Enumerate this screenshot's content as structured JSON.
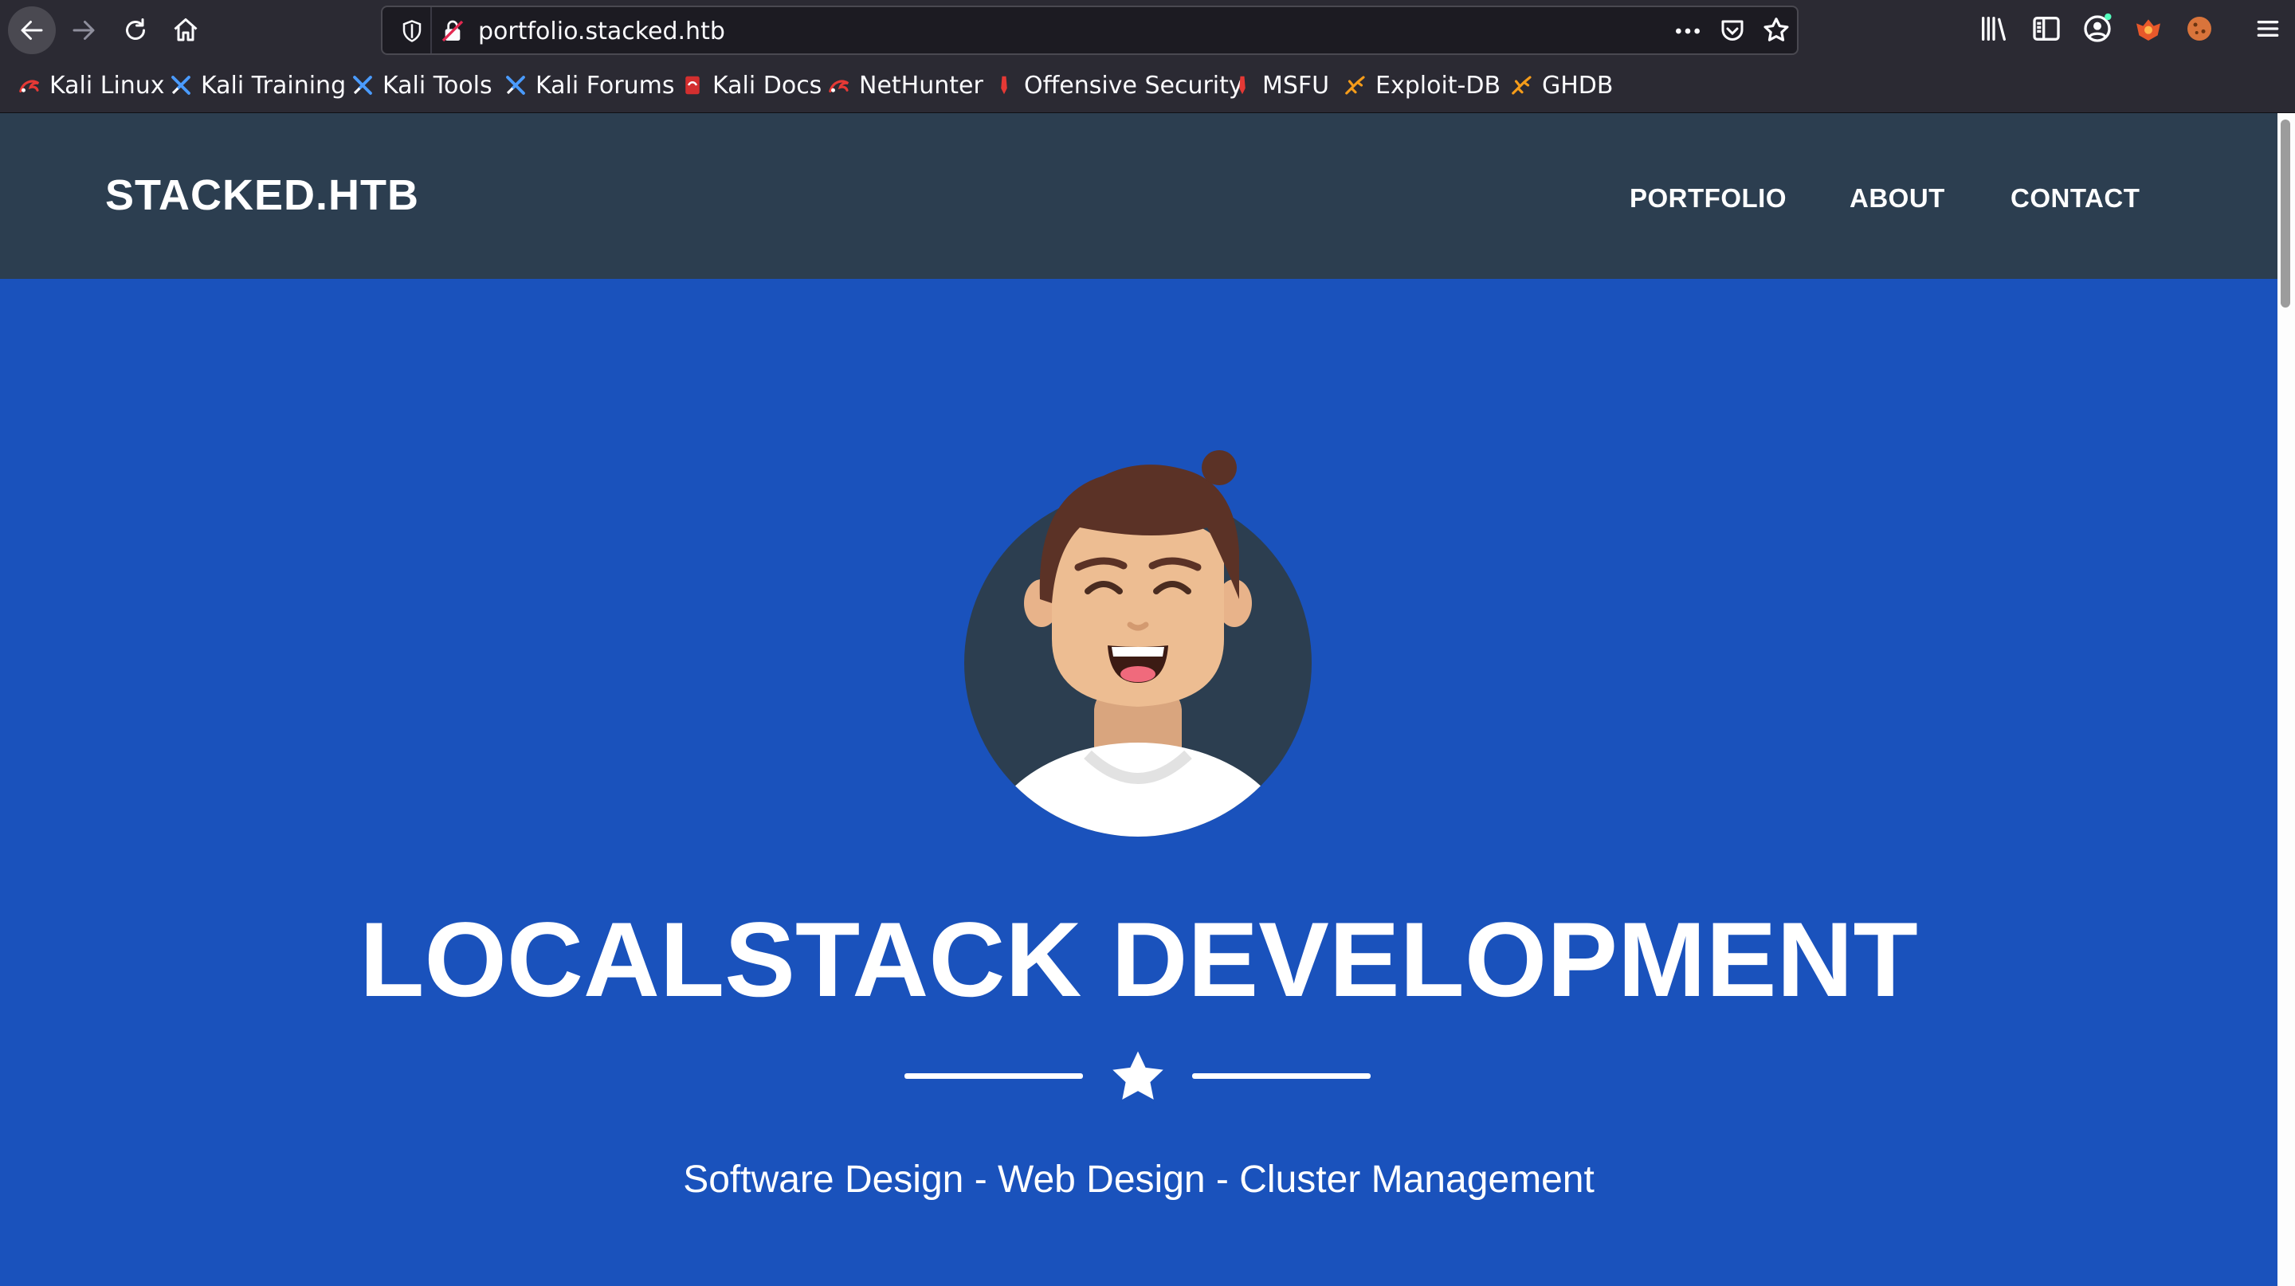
{
  "browser": {
    "url": "portfolio.stacked.htb",
    "bookmarks": [
      {
        "label": "Kali Linux",
        "icon": "kali-dragon-icon"
      },
      {
        "label": "Kali Training",
        "icon": "kali-training-icon"
      },
      {
        "label": "Kali Tools",
        "icon": "kali-tools-icon"
      },
      {
        "label": "Kali Forums",
        "icon": "kali-forums-icon"
      },
      {
        "label": "Kali Docs",
        "icon": "kali-docs-icon"
      },
      {
        "label": "NetHunter",
        "icon": "nethunter-icon"
      },
      {
        "label": "Offensive Security",
        "icon": "offsec-icon"
      },
      {
        "label": "MSFU",
        "icon": "msfu-icon"
      },
      {
        "label": "Exploit-DB",
        "icon": "exploitdb-icon"
      },
      {
        "label": "GHDB",
        "icon": "ghdb-icon"
      }
    ]
  },
  "site": {
    "brand": "STACKED.HTB",
    "nav": {
      "portfolio": "PORTFOLIO",
      "about": "ABOUT",
      "contact": "CONTACT"
    },
    "headline": "LOCALSTACK DEVELOPMENT",
    "subtitle": "Software Design - Web Design - Cluster Management"
  },
  "colors": {
    "navbar": "#2c3e50",
    "masthead": "#1a52bc",
    "chrome": "#2b2a33"
  }
}
